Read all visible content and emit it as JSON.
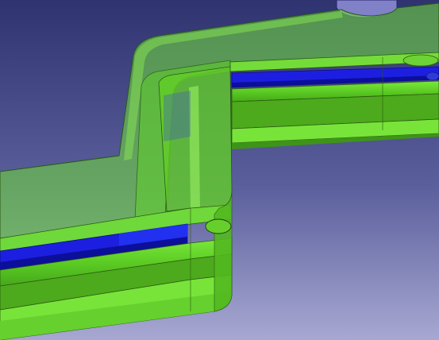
{
  "viewport": {
    "background": {
      "top_color": "#2f3370",
      "mid_color": "#5b5f9c",
      "bottom_color": "#a7a8d2"
    }
  },
  "model": {
    "shape": "z-shaped-extruded-part",
    "layers": [
      {
        "name": "top-plate",
        "color": "#6fd83a",
        "opacity": 0.55
      },
      {
        "name": "slot-inset",
        "color": "#2b2fd8",
        "opacity": 0.95
      },
      {
        "name": "mid-band",
        "color": "#5fd020",
        "opacity": 0.95
      },
      {
        "name": "bottom-band",
        "color": "#7be83a",
        "opacity": 0.95
      }
    ],
    "edge_color": "#1f3b0d",
    "highlight_color": "#8ff04f",
    "shadow_color": "#3f9a18",
    "blue_slot_color": "#1d1fe0",
    "blue_slot_shadow": "#0c0f9a"
  }
}
